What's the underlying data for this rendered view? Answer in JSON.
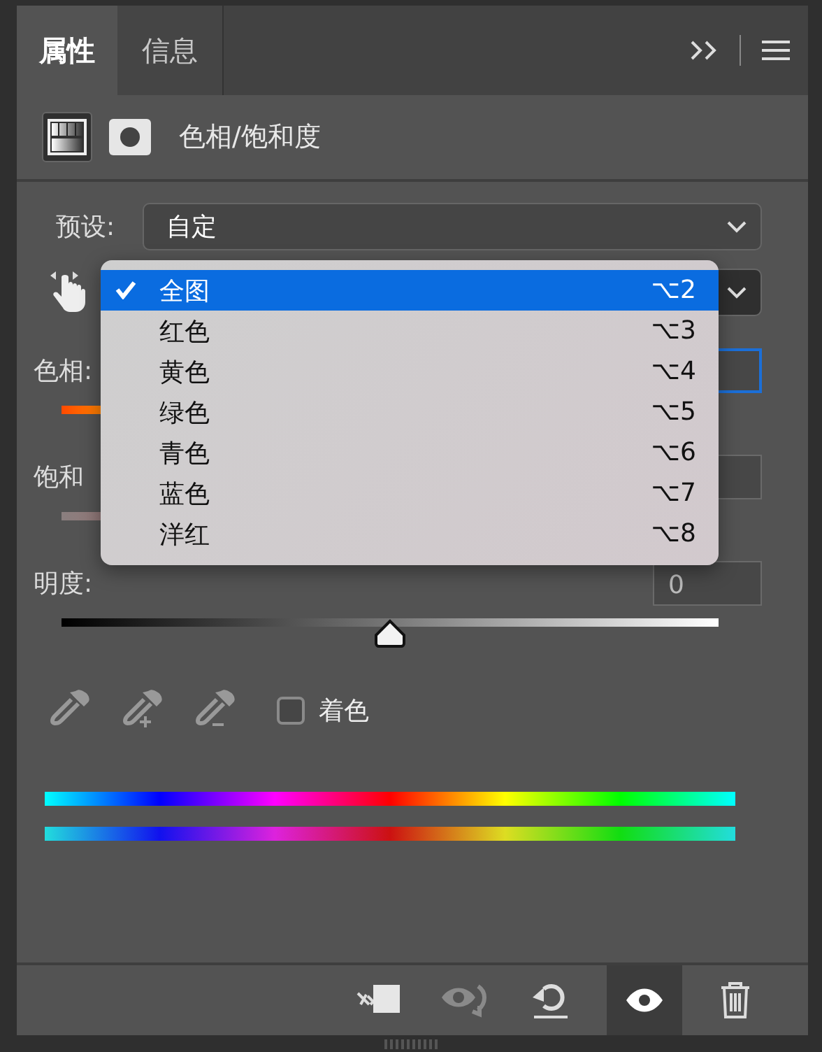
{
  "tabs": [
    {
      "label": "属性",
      "selected": true
    },
    {
      "label": "信息",
      "selected": false
    }
  ],
  "panel_header": {
    "title": "色相/饱和度"
  },
  "preset": {
    "label": "预设:",
    "value": "自定"
  },
  "adjustments": [
    {
      "kind": "hue",
      "label": "色相:"
    },
    {
      "kind": "saturation",
      "label": "饱和"
    },
    {
      "kind": "lightness",
      "label": "明度:",
      "value": "0",
      "level": 0.5
    }
  ],
  "channel_menu": {
    "items": [
      {
        "label": "全图",
        "shortcut": "⌥2",
        "selected": true
      },
      {
        "label": "红色",
        "shortcut": "⌥3",
        "selected": false
      },
      {
        "label": "黄色",
        "shortcut": "⌥4",
        "selected": false
      },
      {
        "label": "绿色",
        "shortcut": "⌥5",
        "selected": false
      },
      {
        "label": "青色",
        "shortcut": "⌥6",
        "selected": false
      },
      {
        "label": "蓝色",
        "shortcut": "⌥7",
        "selected": false
      },
      {
        "label": "洋红",
        "shortcut": "⌥8",
        "selected": false
      }
    ]
  },
  "colorize": {
    "label": "着色",
    "checked": false
  },
  "footer": {
    "visibility_selected": true
  }
}
